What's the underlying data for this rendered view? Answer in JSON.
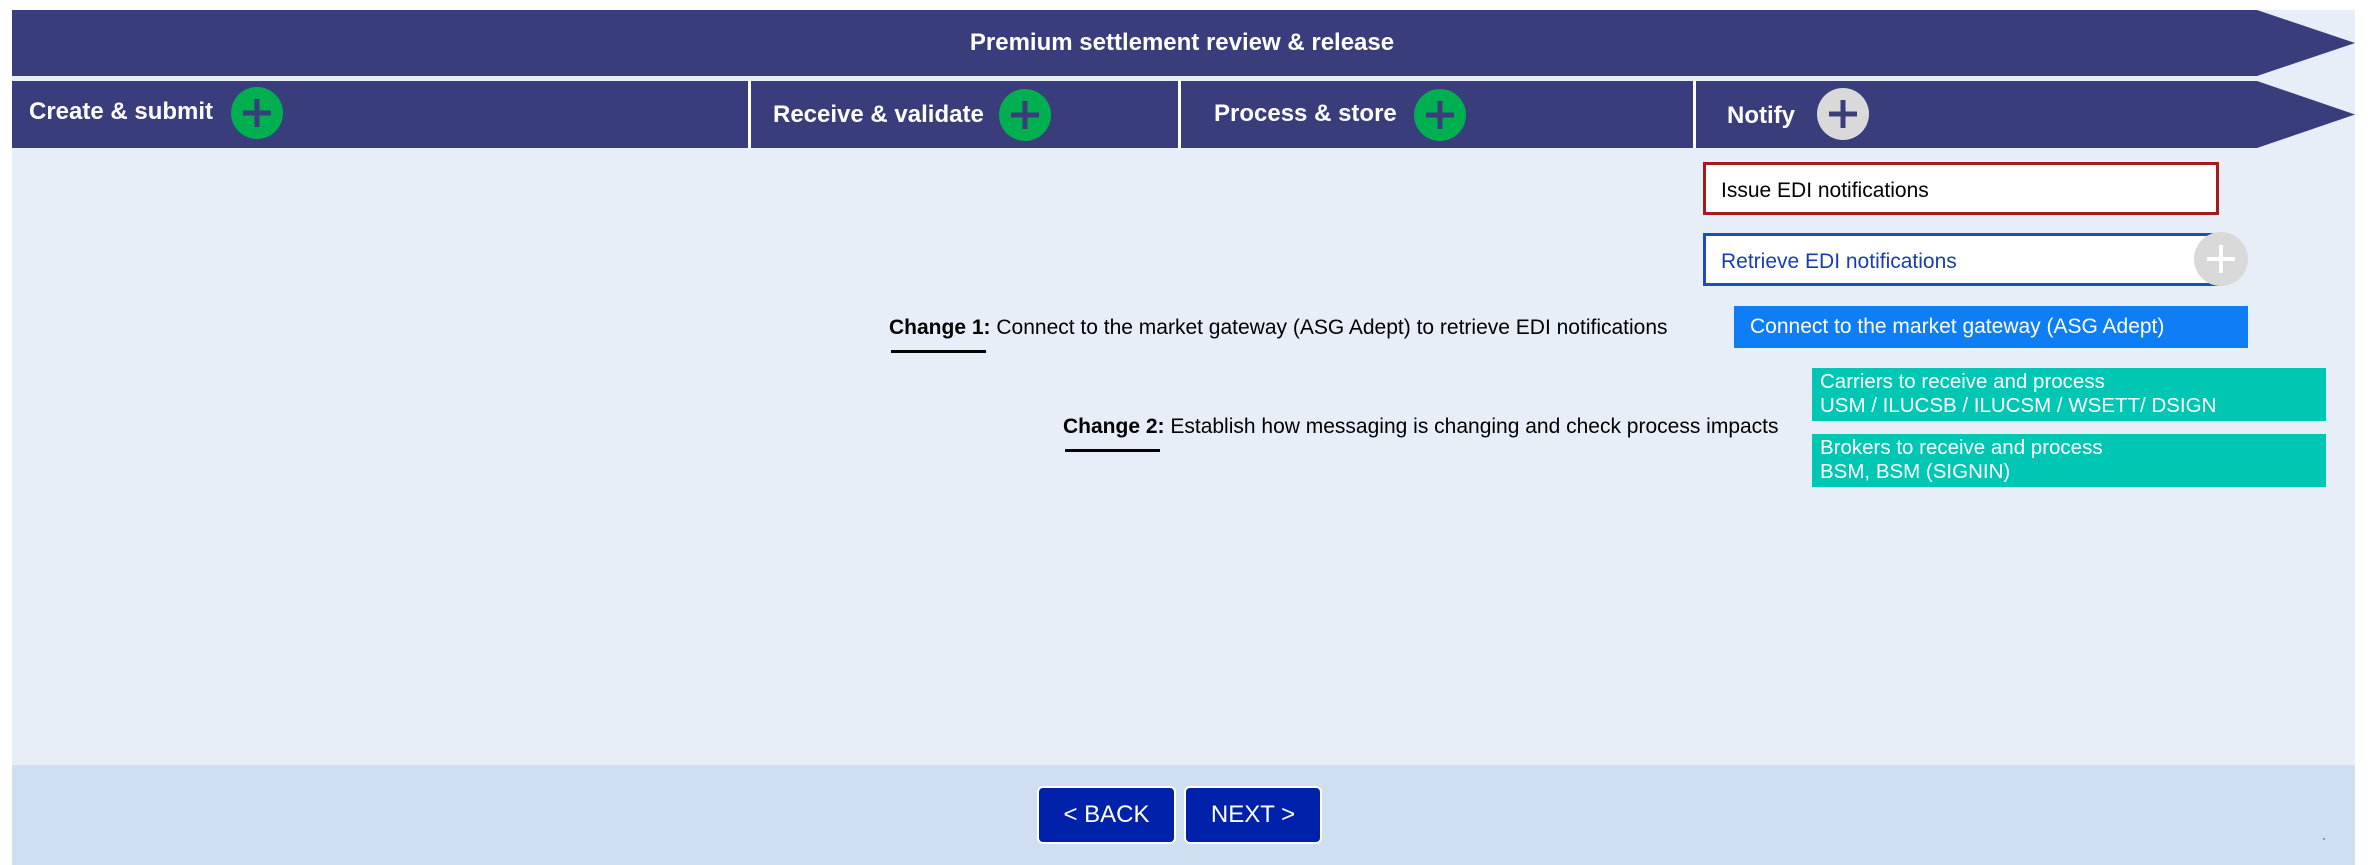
{
  "header": {
    "title": "Premium settlement review & release"
  },
  "stages": [
    {
      "label": "Create & submit"
    },
    {
      "label": "Receive & validate"
    },
    {
      "label": "Process & store"
    },
    {
      "label": "Notify"
    }
  ],
  "colors": {
    "navy": "#3a3d7c",
    "green_plus": "#00b050",
    "gray_plus": "#d9d9d9",
    "teal": "#00c7b4",
    "blue_bar": "#0f7ef5",
    "button": "#0022aa"
  },
  "tasks": {
    "issue": "Issue EDI notifications",
    "retrieve": "Retrieve EDI notifications"
  },
  "changes": [
    {
      "label": "Change 1:",
      "text": "Connect to the market gateway (ASG Adept) to retrieve EDI notifications"
    },
    {
      "label": "Change 2:",
      "text": "Establish how messaging is changing and check process impacts"
    }
  ],
  "details": {
    "gateway": "Connect to the market gateway (ASG Adept)",
    "carriers": {
      "line1": "Carriers to receive and process",
      "line2": "USM / ILUCSB / ILUCSM / WSETT/ DSIGN"
    },
    "brokers": {
      "line1": "Brokers to receive and process",
      "line2": "BSM, BSM (SIGNIN)"
    }
  },
  "nav": {
    "back": "< BACK",
    "next": "NEXT >"
  },
  "icons": {
    "expand": "plus-icon"
  }
}
